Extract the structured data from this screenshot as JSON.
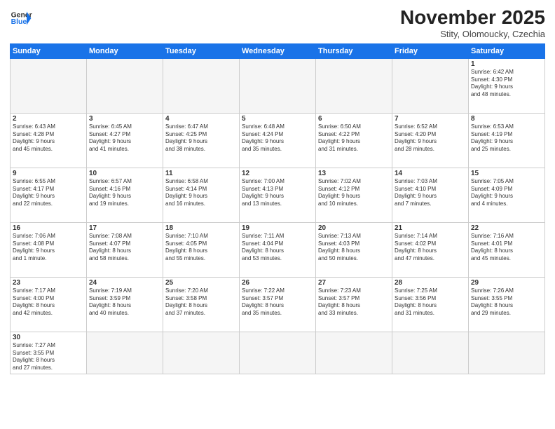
{
  "logo": {
    "line1": "General",
    "line2": "Blue"
  },
  "title": "November 2025",
  "subtitle": "Stity, Olomoucky, Czechia",
  "weekdays": [
    "Sunday",
    "Monday",
    "Tuesday",
    "Wednesday",
    "Thursday",
    "Friday",
    "Saturday"
  ],
  "weeks": [
    [
      {
        "day": "",
        "info": ""
      },
      {
        "day": "",
        "info": ""
      },
      {
        "day": "",
        "info": ""
      },
      {
        "day": "",
        "info": ""
      },
      {
        "day": "",
        "info": ""
      },
      {
        "day": "",
        "info": ""
      },
      {
        "day": "1",
        "info": "Sunrise: 6:42 AM\nSunset: 4:30 PM\nDaylight: 9 hours\nand 48 minutes."
      }
    ],
    [
      {
        "day": "2",
        "info": "Sunrise: 6:43 AM\nSunset: 4:28 PM\nDaylight: 9 hours\nand 45 minutes."
      },
      {
        "day": "3",
        "info": "Sunrise: 6:45 AM\nSunset: 4:27 PM\nDaylight: 9 hours\nand 41 minutes."
      },
      {
        "day": "4",
        "info": "Sunrise: 6:47 AM\nSunset: 4:25 PM\nDaylight: 9 hours\nand 38 minutes."
      },
      {
        "day": "5",
        "info": "Sunrise: 6:48 AM\nSunset: 4:24 PM\nDaylight: 9 hours\nand 35 minutes."
      },
      {
        "day": "6",
        "info": "Sunrise: 6:50 AM\nSunset: 4:22 PM\nDaylight: 9 hours\nand 31 minutes."
      },
      {
        "day": "7",
        "info": "Sunrise: 6:52 AM\nSunset: 4:20 PM\nDaylight: 9 hours\nand 28 minutes."
      },
      {
        "day": "8",
        "info": "Sunrise: 6:53 AM\nSunset: 4:19 PM\nDaylight: 9 hours\nand 25 minutes."
      }
    ],
    [
      {
        "day": "9",
        "info": "Sunrise: 6:55 AM\nSunset: 4:17 PM\nDaylight: 9 hours\nand 22 minutes."
      },
      {
        "day": "10",
        "info": "Sunrise: 6:57 AM\nSunset: 4:16 PM\nDaylight: 9 hours\nand 19 minutes."
      },
      {
        "day": "11",
        "info": "Sunrise: 6:58 AM\nSunset: 4:14 PM\nDaylight: 9 hours\nand 16 minutes."
      },
      {
        "day": "12",
        "info": "Sunrise: 7:00 AM\nSunset: 4:13 PM\nDaylight: 9 hours\nand 13 minutes."
      },
      {
        "day": "13",
        "info": "Sunrise: 7:02 AM\nSunset: 4:12 PM\nDaylight: 9 hours\nand 10 minutes."
      },
      {
        "day": "14",
        "info": "Sunrise: 7:03 AM\nSunset: 4:10 PM\nDaylight: 9 hours\nand 7 minutes."
      },
      {
        "day": "15",
        "info": "Sunrise: 7:05 AM\nSunset: 4:09 PM\nDaylight: 9 hours\nand 4 minutes."
      }
    ],
    [
      {
        "day": "16",
        "info": "Sunrise: 7:06 AM\nSunset: 4:08 PM\nDaylight: 9 hours\nand 1 minute."
      },
      {
        "day": "17",
        "info": "Sunrise: 7:08 AM\nSunset: 4:07 PM\nDaylight: 8 hours\nand 58 minutes."
      },
      {
        "day": "18",
        "info": "Sunrise: 7:10 AM\nSunset: 4:05 PM\nDaylight: 8 hours\nand 55 minutes."
      },
      {
        "day": "19",
        "info": "Sunrise: 7:11 AM\nSunset: 4:04 PM\nDaylight: 8 hours\nand 53 minutes."
      },
      {
        "day": "20",
        "info": "Sunrise: 7:13 AM\nSunset: 4:03 PM\nDaylight: 8 hours\nand 50 minutes."
      },
      {
        "day": "21",
        "info": "Sunrise: 7:14 AM\nSunset: 4:02 PM\nDaylight: 8 hours\nand 47 minutes."
      },
      {
        "day": "22",
        "info": "Sunrise: 7:16 AM\nSunset: 4:01 PM\nDaylight: 8 hours\nand 45 minutes."
      }
    ],
    [
      {
        "day": "23",
        "info": "Sunrise: 7:17 AM\nSunset: 4:00 PM\nDaylight: 8 hours\nand 42 minutes."
      },
      {
        "day": "24",
        "info": "Sunrise: 7:19 AM\nSunset: 3:59 PM\nDaylight: 8 hours\nand 40 minutes."
      },
      {
        "day": "25",
        "info": "Sunrise: 7:20 AM\nSunset: 3:58 PM\nDaylight: 8 hours\nand 37 minutes."
      },
      {
        "day": "26",
        "info": "Sunrise: 7:22 AM\nSunset: 3:57 PM\nDaylight: 8 hours\nand 35 minutes."
      },
      {
        "day": "27",
        "info": "Sunrise: 7:23 AM\nSunset: 3:57 PM\nDaylight: 8 hours\nand 33 minutes."
      },
      {
        "day": "28",
        "info": "Sunrise: 7:25 AM\nSunset: 3:56 PM\nDaylight: 8 hours\nand 31 minutes."
      },
      {
        "day": "29",
        "info": "Sunrise: 7:26 AM\nSunset: 3:55 PM\nDaylight: 8 hours\nand 29 minutes."
      }
    ],
    [
      {
        "day": "30",
        "info": "Sunrise: 7:27 AM\nSunset: 3:55 PM\nDaylight: 8 hours\nand 27 minutes."
      },
      {
        "day": "",
        "info": ""
      },
      {
        "day": "",
        "info": ""
      },
      {
        "day": "",
        "info": ""
      },
      {
        "day": "",
        "info": ""
      },
      {
        "day": "",
        "info": ""
      },
      {
        "day": "",
        "info": ""
      }
    ]
  ]
}
